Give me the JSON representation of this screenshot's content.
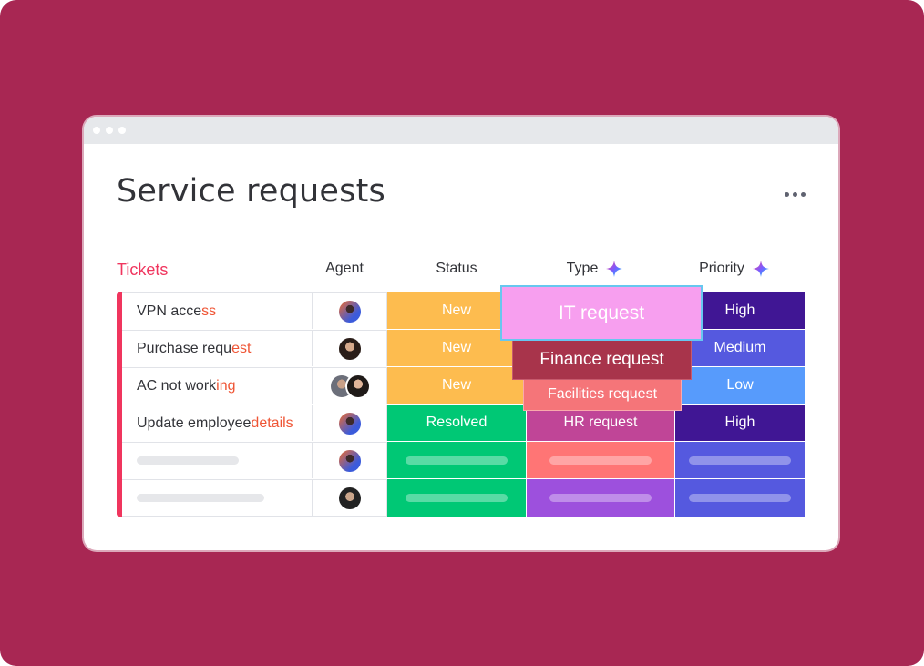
{
  "page": {
    "title": "Service requests",
    "more_icon": "more-dots-icon"
  },
  "group": {
    "title": "Tickets"
  },
  "columns": {
    "agent": "Agent",
    "status": "Status",
    "type": "Type",
    "priority": "Priority",
    "ai_icon": "ai-sparkle-icon"
  },
  "rows": [
    {
      "name_a": "VPN acce",
      "name_b": "ss",
      "agent_avatars": [
        "avatar-1"
      ],
      "status": "New",
      "type": "",
      "priority": "High"
    },
    {
      "name_a": "Purchase requ",
      "name_b": "est",
      "agent_avatars": [
        "avatar-2"
      ],
      "status": "New",
      "type": "",
      "priority": "Medium"
    },
    {
      "name_a": "AC not work",
      "name_b": "ing",
      "agent_avatars": [
        "avatar-3",
        "avatar-4"
      ],
      "status": "New",
      "type": "",
      "priority": "Low"
    },
    {
      "name_a": "Update employee ",
      "name_b": "details",
      "agent_avatars": [
        "avatar-1"
      ],
      "status": "Resolved",
      "type": "HR request",
      "priority": "High"
    },
    {
      "name_a": "",
      "name_b": "",
      "agent_avatars": [
        "avatar-1"
      ],
      "status": "",
      "type": "",
      "priority": ""
    },
    {
      "name_a": "",
      "name_b": "",
      "agent_avatars": [
        "avatar-5"
      ],
      "status": "",
      "type": "",
      "priority": ""
    }
  ],
  "type_options": [
    {
      "label": "IT request",
      "color": "#f79fef"
    },
    {
      "label": "Finance request",
      "color": "#a8344b"
    },
    {
      "label": "Facilities request",
      "color": "#f57579"
    }
  ],
  "colors": {
    "background": "#a82753",
    "accent": "#f0355e",
    "status_new": "#fdbc4f",
    "status_resolved": "#00c875",
    "type_hr": "#c04597",
    "type_coral": "#ff7575",
    "type_purple": "#9d50dd",
    "priority_high": "#401694",
    "priority_medium": "#5559df",
    "priority_low": "#579bfc"
  }
}
